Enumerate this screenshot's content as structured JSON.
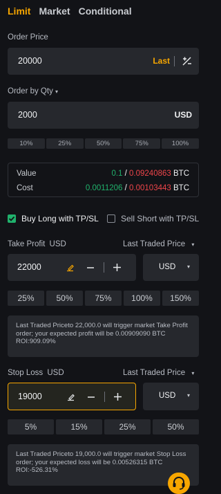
{
  "tabs": [
    "Limit",
    "Market",
    "Conditional"
  ],
  "order_price": {
    "label": "Order Price",
    "value": "20000",
    "last": "Last"
  },
  "order_qty": {
    "label": "Order by Qty",
    "caret": "▾",
    "value": "2000",
    "unit": "USD"
  },
  "qty_percents": [
    "10%",
    "25%",
    "50%",
    "75%",
    "100%"
  ],
  "summary": {
    "value_label": "Value",
    "value_a": "0.1",
    "value_sep": " / ",
    "value_b": "0.09240863",
    "value_unit": "BTC",
    "cost_label": "Cost",
    "cost_a": "0.0011206",
    "cost_sep": " / ",
    "cost_b": "0.00103443",
    "cost_unit": "BTC"
  },
  "checkboxes": {
    "buy_long": "Buy Long with TP/SL",
    "sell_short": "Sell Short with TP/SL"
  },
  "take_profit": {
    "label": "Take Profit",
    "unit_label": "USD",
    "trigger": "Last Traded Price",
    "value": "22000",
    "currency": "USD",
    "percents": [
      "25%",
      "50%",
      "75%",
      "100%",
      "150%"
    ],
    "info": "Last Traded Priceto 22,000.0 will trigger market Take Profit order; your expected profit will be 0.00909090 BTC ROI:909.09%"
  },
  "stop_loss": {
    "label": "Stop Loss",
    "unit_label": "USD",
    "trigger": "Last Traded Price",
    "value": "19000",
    "currency": "USD",
    "percents": [
      "5%",
      "15%",
      "25%",
      "50%"
    ],
    "info": "Last Traded Priceto 19,000.0 will trigger market Stop Loss order; your expected loss will be 0.00526315 BTC ROI:-526.31%"
  },
  "colors": {
    "accent": "#f7a600",
    "green": "#20b26c",
    "red": "#ef454a",
    "bg": "#121317",
    "panel": "#26282d"
  },
  "icons": [
    "adjust-icon",
    "clear-icon",
    "minus-icon",
    "plus-icon",
    "caret-down-icon",
    "check-icon",
    "support-headset-icon"
  ]
}
